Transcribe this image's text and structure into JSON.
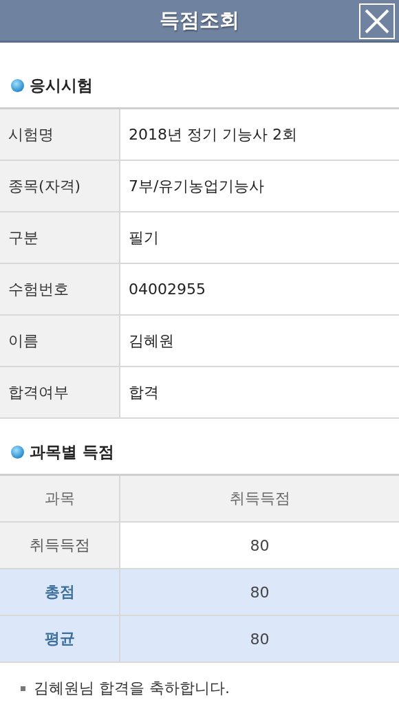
{
  "header": {
    "title": "득점조회"
  },
  "exam_section": {
    "title": "응시시험",
    "rows": [
      {
        "label": "시험명",
        "value": "2018년 정기 기능사 2회"
      },
      {
        "label": "종목(자격)",
        "value": "7부/유기농업기능사"
      },
      {
        "label": "구분",
        "value": "필기"
      },
      {
        "label": "수험번호",
        "value": "04002955"
      },
      {
        "label": "이름",
        "value": "김혜원"
      },
      {
        "label": "합격여부",
        "value": "합격"
      }
    ]
  },
  "score_section": {
    "title": "과목별 득점",
    "rows": [
      {
        "kind": "header",
        "label": "과목",
        "value": "취득득점"
      },
      {
        "kind": "subject",
        "label": "취득득점",
        "value": "80"
      },
      {
        "kind": "total",
        "label": "총점",
        "value": "80"
      },
      {
        "kind": "total",
        "label": "평균",
        "value": "80"
      }
    ]
  },
  "note": "김혜원님 합격을 축하합니다."
}
